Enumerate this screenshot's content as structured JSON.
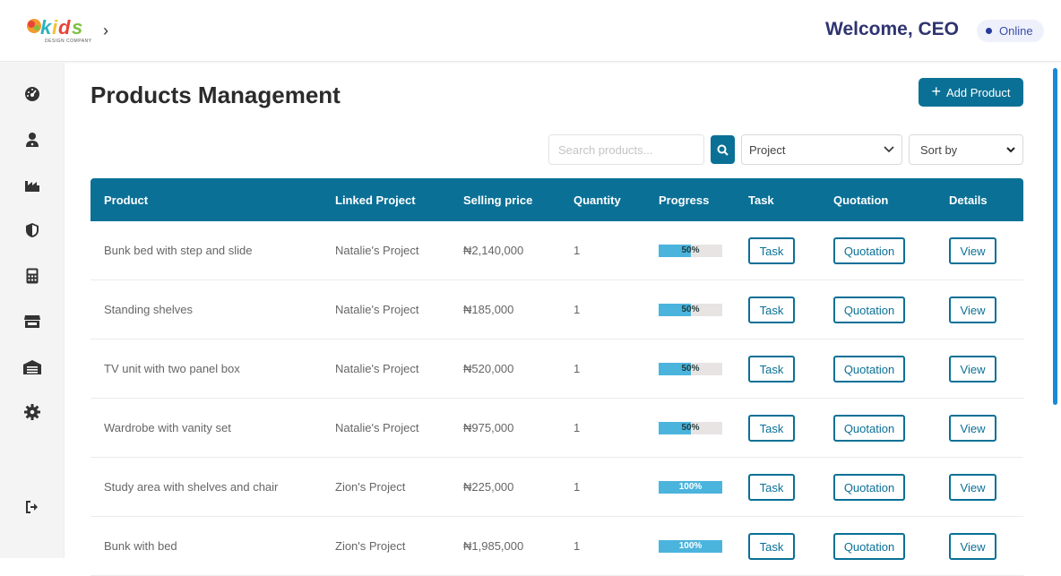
{
  "header": {
    "logo_alt": "kids DESIGN COMPANY",
    "welcome": "Welcome, CEO",
    "status": "Online"
  },
  "sidebar": {
    "icons": [
      "dashboard-gauge-icon",
      "users-icon",
      "factory-icon",
      "shield-icon",
      "calculator-icon",
      "store-icon",
      "warehouse-icon",
      "gear-icon"
    ],
    "logout_icon": "logout-icon"
  },
  "main": {
    "title": "Products Management",
    "add_button": "Add Product",
    "search_placeholder": "Search products...",
    "project_filter": "Project",
    "sort_filter": "Sort by"
  },
  "table": {
    "headers": {
      "product": "Product",
      "project": "Linked Project",
      "price": "Selling price",
      "quantity": "Quantity",
      "progress": "Progress",
      "task": "Task",
      "quotation": "Quotation",
      "details": "Details"
    },
    "rows": [
      {
        "product": "Bunk bed with step and slide",
        "project": "Natalie's Project",
        "price": "₦2,140,000",
        "quantity": "1",
        "progress": 50,
        "progress_label": "50%",
        "task": "Task",
        "quotation": "Quotation",
        "details": "View"
      },
      {
        "product": "Standing shelves",
        "project": "Natalie's Project",
        "price": "₦185,000",
        "quantity": "1",
        "progress": 50,
        "progress_label": "50%",
        "task": "Task",
        "quotation": "Quotation",
        "details": "View"
      },
      {
        "product": "TV unit with two panel box",
        "project": "Natalie's Project",
        "price": "₦520,000",
        "quantity": "1",
        "progress": 50,
        "progress_label": "50%",
        "task": "Task",
        "quotation": "Quotation",
        "details": "View"
      },
      {
        "product": "Wardrobe with vanity set",
        "project": "Natalie's Project",
        "price": "₦975,000",
        "quantity": "1",
        "progress": 50,
        "progress_label": "50%",
        "task": "Task",
        "quotation": "Quotation",
        "details": "View"
      },
      {
        "product": "Study area with shelves and chair",
        "project": "Zion's Project",
        "price": "₦225,000",
        "quantity": "1",
        "progress": 100,
        "progress_label": "100%",
        "task": "Task",
        "quotation": "Quotation",
        "details": "View"
      },
      {
        "product": "Bunk with bed",
        "project": "Zion's Project",
        "price": "₦1,985,000",
        "quantity": "1",
        "progress": 100,
        "progress_label": "100%",
        "task": "Task",
        "quotation": "Quotation",
        "details": "View"
      }
    ]
  },
  "colors": {
    "primary": "#0a7096",
    "progress_fill": "#4bb4dd",
    "welcome_text": "#2f3470",
    "scrollbar": "#1a8ad6"
  }
}
